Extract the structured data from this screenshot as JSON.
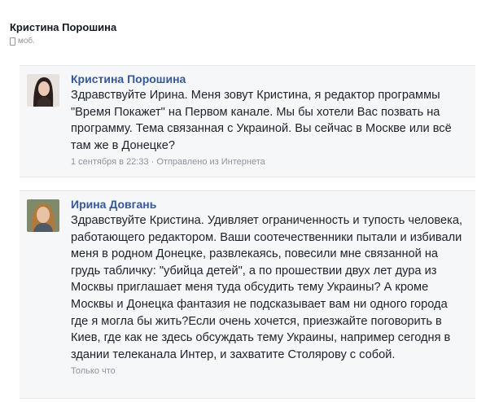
{
  "conversation": {
    "title": "Кристина Порошина",
    "subtitle": "моб."
  },
  "messages": [
    {
      "sender": "Кристина Порошина",
      "text": "Здравствуйте Ирина. Меня зовут Кристина, я редактор программы \"Время Покажет\" на Первом канале. Мы бы хотели Вас позвать на программу. Тема связанная с Украиной. Вы сейчас в Москве или всё там же в Донецке?",
      "meta": "1 сентября в 22:33 · Отправлено из Интернета"
    },
    {
      "sender": "Ирина Довгань",
      "text": "Здравствуйте Кристина. Удивляет ограниченность и тупость человека, работающего редактором. Ваши соотечественники пытали и избивали меня в родном Донецке, развлекаясь, повесили мне связанной на грудь табличку: \"убийца детей\", а по прошествии двух лет дура из Москвы приглашает меня туда обсудить тему Украины? А кроме Москвы и Донецка фантазия не подсказывает вам ни одного города где я могла бы жить?Если очень хочется, приезжайте поговорить в Киев, где как не здесь обсуждать тему Украины, например сегодня в здании телеканала Интер, и захватите Столярову с собой.",
      "meta": "Только что"
    }
  ],
  "icons": {
    "device": "mobile-phone-icon"
  }
}
